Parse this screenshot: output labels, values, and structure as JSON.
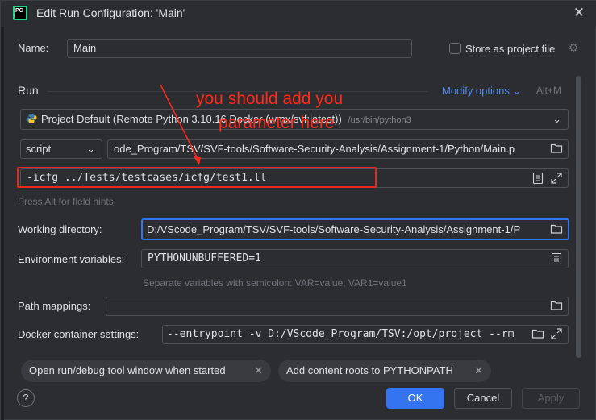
{
  "window": {
    "title": "Edit Run Configuration: 'Main'",
    "app_logo_text": "PC"
  },
  "name": {
    "label": "Name:",
    "value": "Main",
    "store_project_label": "Store as project file",
    "store_project_checked": false
  },
  "run": {
    "section_label": "Run",
    "modify_options": "Modify options",
    "modify_shortcut": "Alt+M",
    "interpreter": "Project Default (Remote Python 3.10.16 Docker (wmx/svf:latest))",
    "interpreter_path": "/usr/bin/python3",
    "run_type": "script",
    "script_path": "ode_Program/TSV/SVF-tools/Software-Security-Analysis/Assignment-1/Python/Main.p",
    "parameters": "-icfg ../Tests/testcases/icfg/test1.ll",
    "parameters_hint": "Press Alt for field hints"
  },
  "working_directory": {
    "label": "Working directory:",
    "value": "D:/VScode_Program/TSV/SVF-tools/Software-Security-Analysis/Assignment-1/P"
  },
  "env": {
    "label": "Environment variables:",
    "value": "PYTHONUNBUFFERED=1",
    "hint": "Separate variables with semicolon: VAR=value; VAR1=value1"
  },
  "path_mappings": {
    "label": "Path mappings:",
    "value": ""
  },
  "docker": {
    "label": "Docker container settings:",
    "value": "--entrypoint -v D:/VScode_Program/TSV:/opt/project --rm"
  },
  "chips": [
    {
      "label": "Open run/debug tool window when started"
    },
    {
      "label": "Add content roots to PYTHONPATH"
    }
  ],
  "buttons": {
    "ok": "OK",
    "cancel": "Cancel",
    "apply": "Apply",
    "help": "?"
  },
  "annotation": {
    "line1": "you should add you",
    "line2": "parameter here",
    "color": "#ff2a1a"
  },
  "colors": {
    "accent": "#3574f0",
    "link": "#548af7",
    "background": "#2b2d30"
  }
}
